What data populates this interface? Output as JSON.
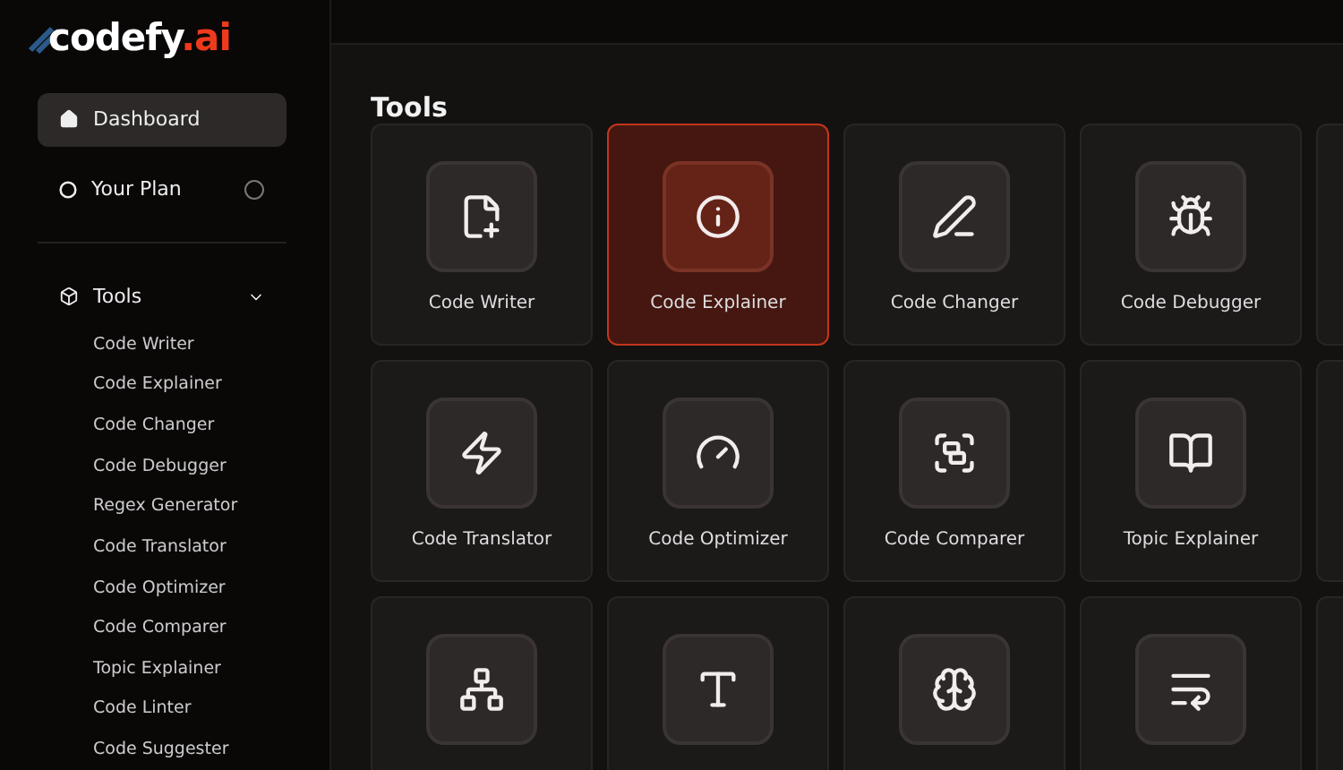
{
  "logo": {
    "name": "codefy",
    "suffix": ".ai"
  },
  "sidebar": {
    "items": [
      {
        "label": "Dashboard",
        "selected": true
      },
      {
        "label": "Your Plan",
        "selected": false
      }
    ],
    "section": {
      "label": "Tools",
      "expanded": true,
      "children": [
        {
          "label": "Code Writer"
        },
        {
          "label": "Code Explainer"
        },
        {
          "label": "Code Changer"
        },
        {
          "label": "Code Debugger"
        },
        {
          "label": "Regex Generator"
        },
        {
          "label": "Code Translator"
        },
        {
          "label": "Code Optimizer"
        },
        {
          "label": "Code Comparer"
        },
        {
          "label": "Topic Explainer"
        },
        {
          "label": "Code Linter"
        },
        {
          "label": "Code Suggester"
        }
      ]
    }
  },
  "tools": {
    "title": "Tools",
    "cards": [
      {
        "label": "Code Writer",
        "selected": false
      },
      {
        "label": "Code Explainer",
        "selected": true
      },
      {
        "label": "Code Changer",
        "selected": false
      },
      {
        "label": "Code Debugger",
        "selected": false
      },
      {
        "selected": false
      },
      {
        "label": "Code Translator",
        "selected": false
      },
      {
        "label": "Code Optimizer",
        "selected": false
      },
      {
        "label": "Code Comparer",
        "selected": false
      },
      {
        "label": "Topic Explainer",
        "selected": false
      },
      {
        "selected": false
      },
      {
        "selected": false
      },
      {
        "selected": false
      },
      {
        "selected": false
      },
      {
        "selected": false
      },
      {
        "selected": false
      }
    ]
  }
}
